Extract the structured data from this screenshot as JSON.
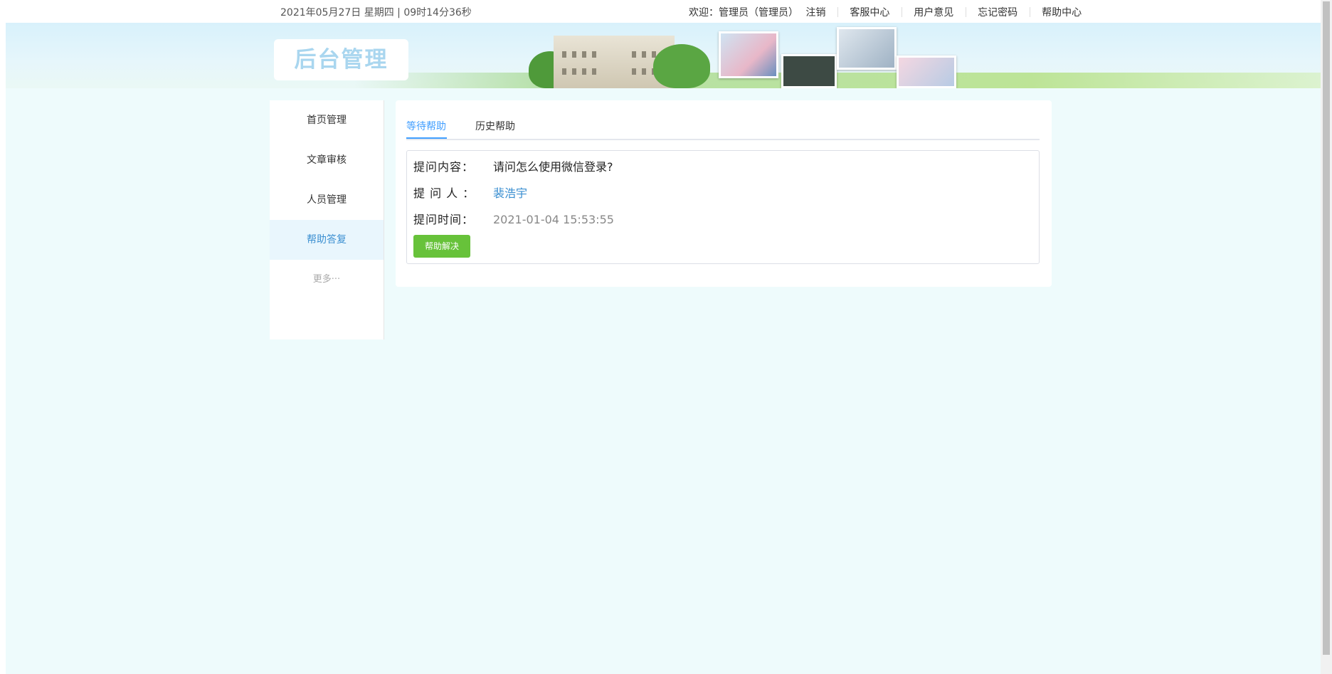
{
  "topbar": {
    "datetime": "2021年05月27日 星期四 | 09时14分36秒",
    "welcome": "欢迎：管理员（管理员）",
    "logout": "注销",
    "links": [
      "客服中心",
      "用户意见",
      "忘记密码",
      "帮助中心"
    ]
  },
  "banner": {
    "title": "后台管理"
  },
  "sidebar": {
    "items": [
      {
        "label": "首页管理"
      },
      {
        "label": "文章审核"
      },
      {
        "label": "人员管理"
      },
      {
        "label": "帮助答复"
      },
      {
        "label": "更多···"
      }
    ],
    "active_index": 3
  },
  "tabs": [
    {
      "label": "等待帮助",
      "active": true
    },
    {
      "label": "历史帮助",
      "active": false
    }
  ],
  "question": {
    "content_label": "提问内容：",
    "content": "请问怎么使用微信登录?",
    "user_label": "提 问 人 ：",
    "user": "裴浩宇",
    "time_label": "提问时间：",
    "time": "2021-01-04 15:53:55",
    "resolve_button": "帮助解决"
  },
  "colors": {
    "accent": "#409eff",
    "button": "#67c23a",
    "page_bg": "#eefbfc"
  }
}
